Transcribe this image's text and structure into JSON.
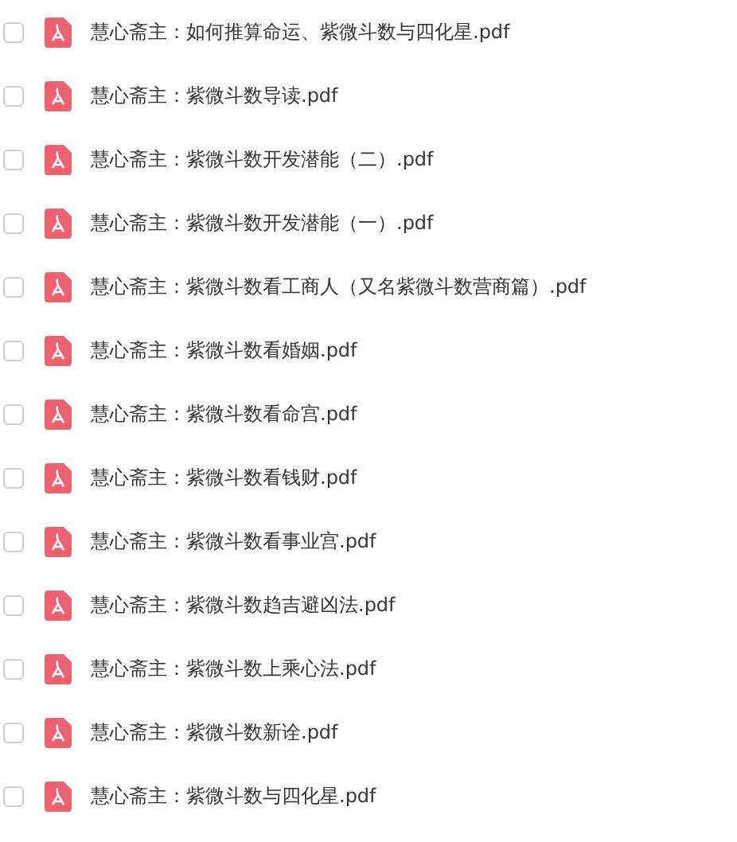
{
  "files": [
    {
      "name": "慧心斋主：如何推算命运、紫微斗数与四化星.pdf",
      "checked": false
    },
    {
      "name": "慧心斋主：紫微斗数导读.pdf",
      "checked": false
    },
    {
      "name": "慧心斋主：紫微斗数开发潜能（二）.pdf",
      "checked": false
    },
    {
      "name": "慧心斋主：紫微斗数开发潜能（一）.pdf",
      "checked": false
    },
    {
      "name": "慧心斋主：紫微斗数看工商人（又名紫微斗数营商篇）.pdf",
      "checked": false
    },
    {
      "name": "慧心斋主：紫微斗数看婚姻.pdf",
      "checked": false
    },
    {
      "name": "慧心斋主：紫微斗数看命宫.pdf",
      "checked": false
    },
    {
      "name": "慧心斋主：紫微斗数看钱财.pdf",
      "checked": false
    },
    {
      "name": "慧心斋主：紫微斗数看事业宫.pdf",
      "checked": false
    },
    {
      "name": "慧心斋主：紫微斗数趋吉避凶法.pdf",
      "checked": false
    },
    {
      "name": "慧心斋主：紫微斗数上乘心法.pdf",
      "checked": false
    },
    {
      "name": "慧心斋主：紫微斗数新诠.pdf",
      "checked": false
    },
    {
      "name": "慧心斋主：紫微斗数与四化星.pdf",
      "checked": false
    }
  ]
}
